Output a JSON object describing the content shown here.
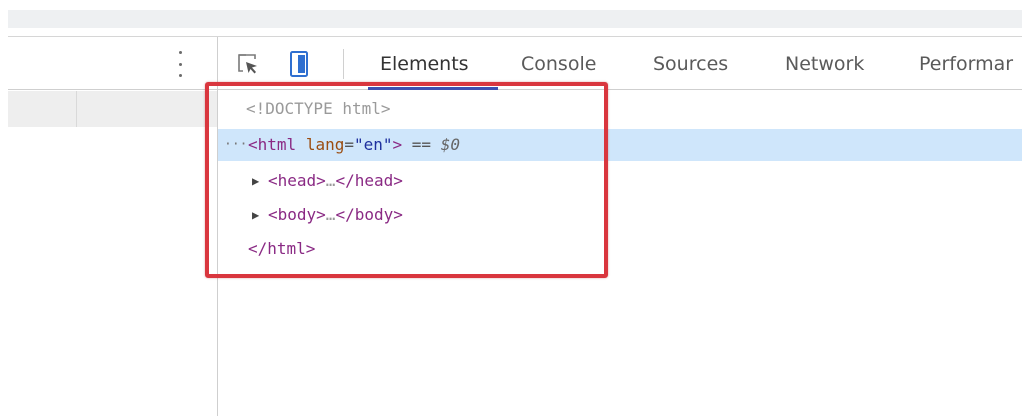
{
  "devtools": {
    "tabs": [
      {
        "label": "Elements",
        "active": true
      },
      {
        "label": "Console",
        "active": false
      },
      {
        "label": "Sources",
        "active": false
      },
      {
        "label": "Network",
        "active": false
      },
      {
        "label": "Performar",
        "active": false
      }
    ]
  },
  "tree": {
    "doctype": "<!DOCTYPE html>",
    "html_open": {
      "dots": "···",
      "open": "<html",
      "attr_name": "lang",
      "attr_eq": "=",
      "attr_value": "\"en\"",
      "close": ">",
      "eq": " == ",
      "ref": "$0"
    },
    "head": {
      "arrow": "▶",
      "open": "<head>",
      "ellipsis": "…",
      "close": "</head>"
    },
    "body": {
      "arrow": "▶",
      "open": "<body>",
      "ellipsis": "…",
      "close": "</body>"
    },
    "html_close": "</html>"
  },
  "annotation": {
    "color": "#d9363e"
  },
  "colors": {
    "accent": "#3e4fb0",
    "selected_row": "#cfe6fb"
  }
}
